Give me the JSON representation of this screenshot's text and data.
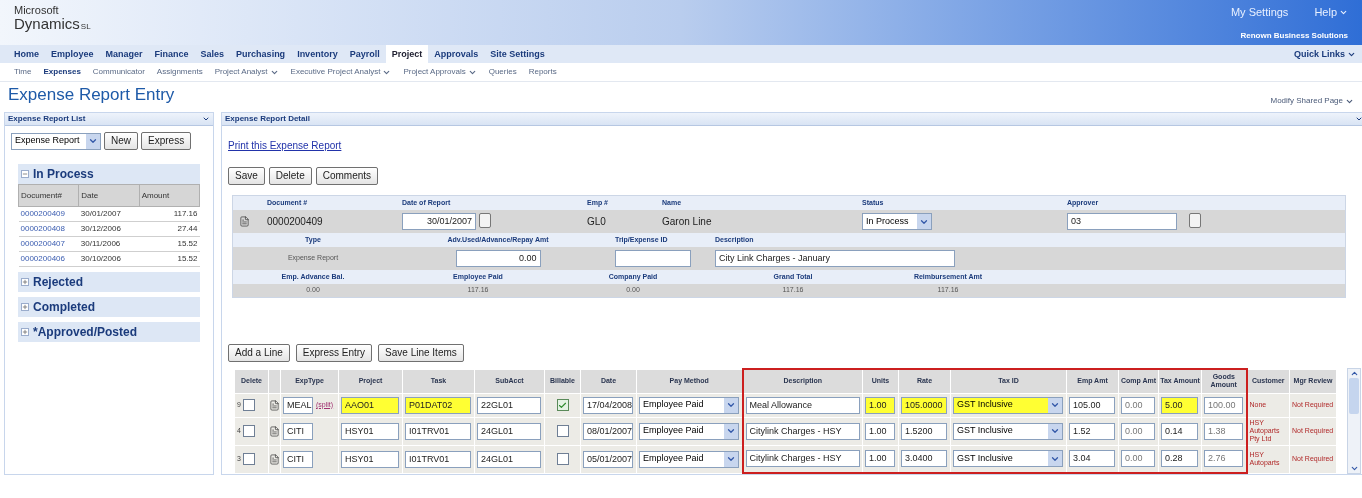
{
  "banner": {
    "logo_top": "Microsoft",
    "logo_main": "Dynamics",
    "logo_suffix": "SL",
    "links": [
      {
        "label": "My Settings",
        "dropdown": false
      },
      {
        "label": "Help",
        "dropdown": true
      }
    ],
    "company": "Renown Business Solutions"
  },
  "nav": {
    "tabs": [
      {
        "label": "Home",
        "selected": false
      },
      {
        "label": "Employee",
        "selected": false
      },
      {
        "label": "Manager",
        "selected": false
      },
      {
        "label": "Finance",
        "selected": false
      },
      {
        "label": "Sales",
        "selected": false
      },
      {
        "label": "Purchasing",
        "selected": false
      },
      {
        "label": "Inventory",
        "selected": false
      },
      {
        "label": "Payroll",
        "selected": false
      },
      {
        "label": "Project",
        "selected": true
      },
      {
        "label": "Approvals",
        "selected": false
      },
      {
        "label": "Site Settings",
        "selected": false
      }
    ],
    "quick_links": "Quick Links"
  },
  "subnav": [
    {
      "label": "Time",
      "selected": false,
      "dropdown": false
    },
    {
      "label": "Expenses",
      "selected": true,
      "dropdown": false
    },
    {
      "label": "Communicator",
      "selected": false,
      "dropdown": false
    },
    {
      "label": "Assignments",
      "selected": false,
      "dropdown": false
    },
    {
      "label": "Project Analyst",
      "selected": false,
      "dropdown": true
    },
    {
      "label": "Executive Project Analyst",
      "selected": false,
      "dropdown": true
    },
    {
      "label": "Project Approvals",
      "selected": false,
      "dropdown": true
    },
    {
      "label": "Queries",
      "selected": false,
      "dropdown": false
    },
    {
      "label": "Reports",
      "selected": false,
      "dropdown": false
    }
  ],
  "page_title": "Expense Report Entry",
  "modify_link": "Modify Shared Page",
  "list_panel": {
    "title": "Expense Report List",
    "type_select": "Expense Report",
    "buttons": [
      "New",
      "Express"
    ],
    "groups": [
      {
        "label": "In Process",
        "expanded": true,
        "columns": [
          "Document#",
          "Date",
          "Amount"
        ],
        "rows": [
          {
            "document": "0000200409",
            "date": "30/01/2007",
            "amount": "117.16"
          },
          {
            "document": "0000200408",
            "date": "30/12/2006",
            "amount": "27.44"
          },
          {
            "document": "0000200407",
            "date": "30/11/2006",
            "amount": "15.52"
          },
          {
            "document": "0000200406",
            "date": "30/10/2006",
            "amount": "15.52"
          }
        ]
      },
      {
        "label": "Rejected",
        "expanded": false
      },
      {
        "label": "Completed",
        "expanded": false
      },
      {
        "label": "*Approved/Posted",
        "expanded": false
      }
    ]
  },
  "detail_panel": {
    "title": "Expense Report Detail",
    "print_link": "Print this Expense Report",
    "buttons": [
      "Save",
      "Delete",
      "Comments"
    ],
    "header_sections": [
      {
        "fields": [
          {
            "label": "Document #",
            "value": "0000200409",
            "kind": "text"
          },
          {
            "label": "Date of Report",
            "value": "30/01/2007",
            "kind": "date"
          },
          {
            "label": "Emp #",
            "value": "GL0",
            "kind": "text"
          },
          {
            "label": "Name",
            "value": "Garon Line",
            "kind": "text"
          },
          {
            "label": "Status",
            "value": "In Process",
            "kind": "select"
          },
          {
            "label": "Approver",
            "value": "03",
            "kind": "lookup"
          }
        ]
      },
      {
        "fields": [
          {
            "label": "Type",
            "value": "Expense Report",
            "kind": "small"
          },
          {
            "label": "Adv.Used/Advance/Repay Amt",
            "value": "0.00",
            "kind": "amount"
          },
          {
            "label": "Trip/Expense ID",
            "kind": "input"
          },
          {
            "label": "Description",
            "value": "City Link Charges - January",
            "kind": "input"
          }
        ]
      },
      {
        "fields": [
          {
            "label": "Emp. Advance Bal.",
            "value": "0.00",
            "kind": "small"
          },
          {
            "label": "Employee Paid",
            "value": "117.16",
            "kind": "small"
          },
          {
            "label": "Company Paid",
            "value": "0.00",
            "kind": "small"
          },
          {
            "label": "Grand Total",
            "value": "117.16",
            "kind": "small"
          },
          {
            "label": "Reimbursement Amt",
            "value": "117.16",
            "kind": "small"
          }
        ]
      }
    ],
    "line_buttons": [
      "Add a Line",
      "Express Entry",
      "Save Line Items"
    ],
    "grid": {
      "columns": [
        {
          "label": "Delete",
          "kind": "delete",
          "framed": false
        },
        {
          "label": "ExpType",
          "kind": "exptype",
          "framed": false
        },
        {
          "label": "Project",
          "kind": "input",
          "framed": false
        },
        {
          "label": "Task",
          "kind": "input",
          "framed": false
        },
        {
          "label": "SubAcct",
          "kind": "input",
          "framed": false
        },
        {
          "label": "Billable",
          "kind": "check",
          "framed": false
        },
        {
          "label": "Date",
          "kind": "input",
          "framed": false
        },
        {
          "label": "Pay Method",
          "kind": "select",
          "framed": false
        },
        {
          "label": "Description",
          "kind": "input",
          "framed": true
        },
        {
          "label": "Units",
          "kind": "input",
          "framed": true
        },
        {
          "label": "Rate",
          "kind": "input",
          "framed": true
        },
        {
          "label": "Tax ID",
          "kind": "select",
          "framed": true
        },
        {
          "label": "Emp Amt",
          "kind": "input",
          "framed": true
        },
        {
          "label": "Comp Amt",
          "kind": "readonly",
          "framed": true
        },
        {
          "label": "Tax Amount",
          "kind": "input",
          "framed": true
        },
        {
          "label": "Goods Amount",
          "kind": "readonly",
          "framed": true
        },
        {
          "label": "Customer",
          "kind": "note",
          "framed": false
        },
        {
          "label": "Mgr Review",
          "kind": "note",
          "framed": false
        }
      ],
      "rows": [
        {
          "cells": [
            {
              "value": "9",
              "checked": false
            },
            {
              "value": "MEAL",
              "link": "(split)"
            },
            {
              "value": "AAO01",
              "highlighted": true
            },
            {
              "value": "P01DAT02",
              "highlighted": true
            },
            {
              "value": "22GL01",
              "highlighted": false
            },
            {
              "checked": true
            },
            {
              "value": "17/04/2008",
              "highlighted": false
            },
            {
              "value": "Employee Paid",
              "highlighted": false
            },
            {
              "value": "Meal Allowance",
              "highlighted": false
            },
            {
              "value": "1.00",
              "highlighted": true
            },
            {
              "value": "105.0000",
              "highlighted": true
            },
            {
              "value": "GST Inclusive",
              "highlighted": true
            },
            {
              "value": "105.00",
              "highlighted": false
            },
            {
              "value": "0.00"
            },
            {
              "value": "5.00",
              "highlighted": true
            },
            {
              "value": "100.00"
            },
            {
              "value": "None"
            },
            {
              "value": "Not Required"
            }
          ]
        },
        {
          "cells": [
            {
              "value": "4",
              "checked": false
            },
            {
              "value": "CITI"
            },
            {
              "value": "HSY01",
              "highlighted": false
            },
            {
              "value": "I01TRV01",
              "highlighted": false
            },
            {
              "value": "24GL01",
              "highlighted": false
            },
            {
              "checked": false
            },
            {
              "value": "08/01/2007",
              "highlighted": false
            },
            {
              "value": "Employee Paid",
              "highlighted": false
            },
            {
              "value": "Citylink Charges - HSY",
              "highlighted": false
            },
            {
              "value": "1.00",
              "highlighted": false
            },
            {
              "value": "1.5200",
              "highlighted": false
            },
            {
              "value": "GST Inclusive",
              "highlighted": false
            },
            {
              "value": "1.52",
              "highlighted": false
            },
            {
              "value": "0.00"
            },
            {
              "value": "0.14",
              "highlighted": false
            },
            {
              "value": "1.38"
            },
            {
              "value": "HSY Autoparts Pty Ltd"
            },
            {
              "value": "Not Required"
            }
          ]
        },
        {
          "cells": [
            {
              "value": "3",
              "checked": false
            },
            {
              "value": "CITI"
            },
            {
              "value": "HSY01",
              "highlighted": false
            },
            {
              "value": "I01TRV01",
              "highlighted": false
            },
            {
              "value": "24GL01",
              "highlighted": false
            },
            {
              "checked": false
            },
            {
              "value": "05/01/2007",
              "highlighted": false
            },
            {
              "value": "Employee Paid",
              "highlighted": false
            },
            {
              "value": "Citylink Charges - HSY",
              "highlighted": false
            },
            {
              "value": "1.00",
              "highlighted": false
            },
            {
              "value": "3.0400",
              "highlighted": false
            },
            {
              "value": "GST Inclusive",
              "highlighted": false
            },
            {
              "value": "3.04",
              "highlighted": false
            },
            {
              "value": "0.00"
            },
            {
              "value": "0.28",
              "highlighted": false
            },
            {
              "value": "2.76"
            },
            {
              "value": "HSY Autoparts"
            },
            {
              "value": "Not Required"
            }
          ]
        }
      ]
    }
  }
}
